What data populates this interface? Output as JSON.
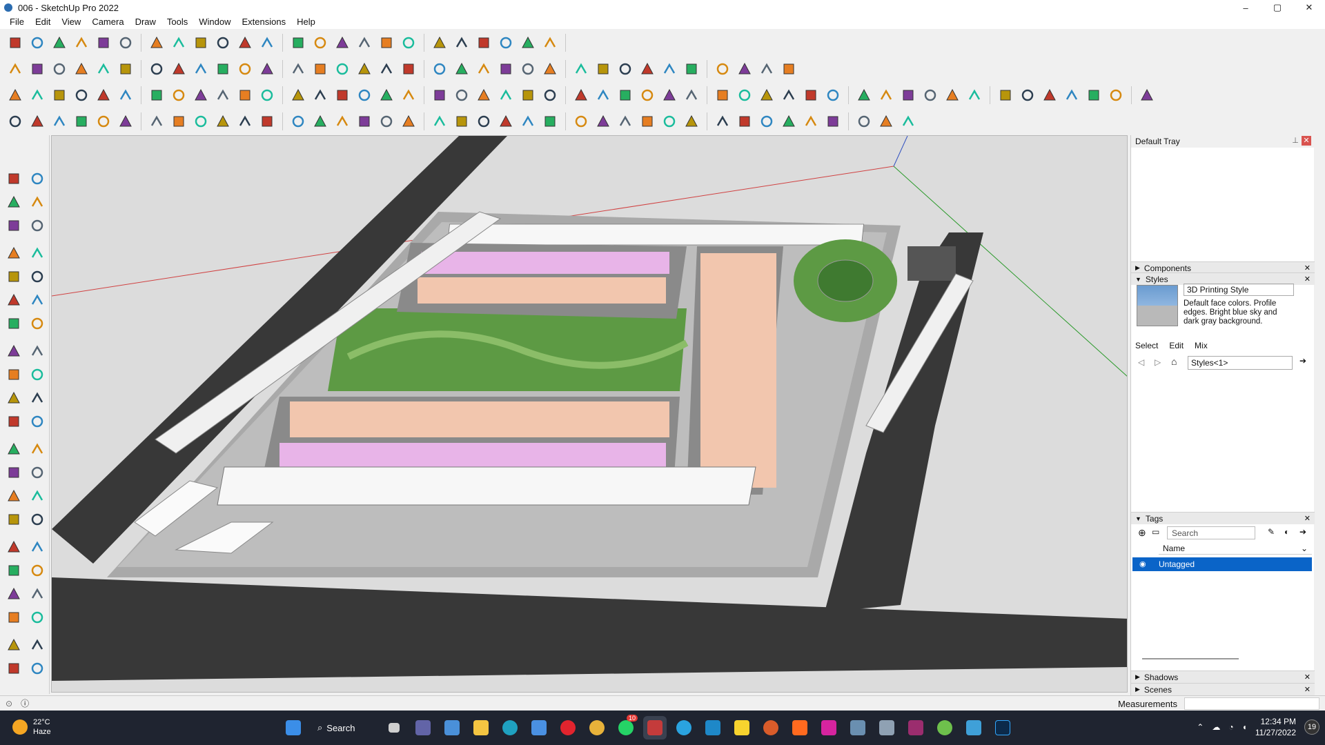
{
  "window": {
    "title": "006 - SketchUp Pro 2022",
    "minimize": "–",
    "maximize": "▢",
    "close": "✕"
  },
  "menu": [
    "File",
    "Edit",
    "View",
    "Camera",
    "Draw",
    "Tools",
    "Window",
    "Extensions",
    "Help"
  ],
  "toolbar_icons": {
    "row1": [
      "search",
      "select",
      "eraser",
      "line",
      "arc",
      "shapes",
      "push-pull",
      "move",
      "rotate",
      "scale",
      "tape",
      "text",
      "paint",
      "orbit",
      "pan",
      "zoom",
      "zoom-extents",
      "section",
      "layers",
      "styles",
      "tags",
      "warehouse",
      "extension-warehouse",
      "sandbox"
    ],
    "row2": [
      "camera",
      "cube",
      "box",
      "grass",
      "shadow",
      "component",
      "copy",
      "place",
      "dimension",
      "front",
      "back",
      "left",
      "tag",
      "pencil",
      "follow",
      "circle",
      "ellipse",
      "polygon",
      "rectangle",
      "curve",
      "spiral",
      "leaf",
      "diamond",
      "paint-bucket",
      "rule",
      "red-arrow",
      "blue-arrow",
      "green-arrow",
      "up-arrow",
      "north-arrow",
      "x-arrow",
      "fill",
      "flatten",
      "solid"
    ],
    "row3": [
      "gear",
      "level",
      "disk",
      "angle",
      "compass",
      "burst",
      "dome",
      "bubble",
      "sphere",
      "grid",
      "wall",
      "box-3d",
      "render",
      "wrap",
      "ball",
      "bucket",
      "cycle",
      "rotate-3d",
      "window",
      "frame",
      "copy-window",
      "map",
      "knife",
      "chain",
      "scissors",
      "cut",
      "scissor",
      "warp",
      "ring",
      "clip",
      "weld",
      "pull",
      "taper",
      "bridge",
      "angle-line",
      "corner",
      "vertex",
      "curl",
      "tube",
      "gate",
      "fence",
      "ladder",
      "drawer",
      "roof",
      "grid3",
      "stair",
      "beam",
      "truss",
      "slope"
    ],
    "row4": [
      "plane-blue",
      "plane-teal",
      "plane-yellow",
      "plane-green",
      "plane-red",
      "plane-grey",
      "rope",
      "red-block",
      "stack",
      "page",
      "box-wood",
      "wrench",
      "chain2",
      "dotted",
      "cross-red",
      "cross-green",
      "cross-blue",
      "cone",
      "tower",
      "warning",
      "loop",
      "swirl",
      "knot",
      "move4",
      "bucket2",
      "magnet",
      "hanger",
      "axes",
      "stair2",
      "cubes",
      "gem",
      "gate2",
      "frame2",
      "hatch",
      "grid-orange",
      "grid-gold",
      "dots",
      "circle-dot",
      "dice"
    ]
  },
  "left_toolbar_icons": [
    "select-arrow",
    "orbit",
    "paint-bucket",
    "eraser",
    "component",
    "measure",
    "line",
    "freehand",
    "rectangle",
    "rotated-rect",
    "circle",
    "polygon",
    "arc",
    "arc-2pt",
    "pie",
    "arc-3pt",
    "move",
    "push-pull",
    "rotate",
    "follow-me",
    "scale",
    "offset",
    "tape",
    "dimension",
    "protractor",
    "text",
    "axes",
    "3d-text",
    "orbit-2",
    "pan",
    "zoom",
    "zoom-window",
    "zoom-extents",
    "zoom-prev",
    "walk",
    "look",
    "footprints",
    "position",
    "section",
    "section-fill",
    "layer",
    "layer-2"
  ],
  "tray": {
    "title": "Default Tray",
    "components": "Components",
    "styles": {
      "header": "Styles",
      "name": "3D Printing Style",
      "description": "Default face colors. Profile edges. Bright blue sky and dark gray background.",
      "tabs": [
        "Select",
        "Edit",
        "Mix"
      ],
      "collection": "Styles<1>"
    },
    "tags": {
      "header": "Tags",
      "search_placeholder": "Search",
      "column": "Name",
      "rows": [
        "Untagged"
      ]
    },
    "shadows": "Shadows",
    "scenes": "Scenes"
  },
  "status": {
    "measurements": "Measurements"
  },
  "taskbar": {
    "weather_temp": "22°C",
    "weather_text": "Haze",
    "search": "Search",
    "whatsapp_badge": "10",
    "time": "12:34 PM",
    "date": "11/27/2022",
    "notifications": "19"
  },
  "accent_color": "#0a64c8"
}
